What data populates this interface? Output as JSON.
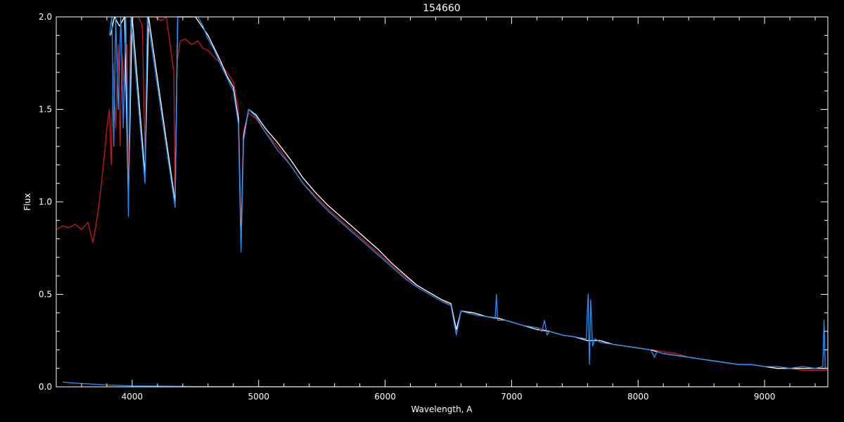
{
  "colors": {
    "background": "#000000",
    "axes": "#ffffff",
    "observed": "#ffffff",
    "model": "#d01818",
    "blue_spectrum": "#1e90ff"
  },
  "chart_data": {
    "type": "line",
    "title": "154660",
    "xlabel": "Wavelength, A",
    "ylabel": "Flux",
    "xlim": [
      3400,
      9500
    ],
    "ylim": [
      0,
      2.0
    ],
    "xticks": [
      4000,
      5000,
      6000,
      7000,
      8000,
      9000
    ],
    "xtick_labels": [
      "4000",
      "5000",
      "6000",
      "7000",
      "8000",
      "9000"
    ],
    "yticks": [
      0.0,
      0.5,
      1.0,
      1.5,
      2.0
    ],
    "ytick_labels": [
      "0.0",
      "0.5",
      "1.0",
      "1.5",
      "2.0"
    ],
    "x_minor_step": 200,
    "y_minor_step": 0.1,
    "grid": false,
    "legend": "none",
    "series": [
      {
        "key": "model",
        "color": "#d01818",
        "points": [
          [
            3400,
            0.85
          ],
          [
            3450,
            0.87
          ],
          [
            3500,
            0.86
          ],
          [
            3550,
            0.88
          ],
          [
            3600,
            0.85
          ],
          [
            3650,
            0.89
          ],
          [
            3690,
            0.78
          ],
          [
            3720,
            0.9
          ],
          [
            3750,
            1.05
          ],
          [
            3780,
            1.25
          ],
          [
            3800,
            1.4
          ],
          [
            3820,
            1.5
          ],
          [
            3835,
            1.2
          ],
          [
            3850,
            1.75
          ],
          [
            3870,
            1.4
          ],
          [
            3890,
            1.85
          ],
          [
            3905,
            1.3
          ],
          [
            3920,
            1.8
          ],
          [
            3940,
            1.6
          ],
          [
            3960,
            1.85
          ],
          [
            3970,
            0.95
          ],
          [
            3985,
            1.9
          ],
          [
            4010,
            2.0
          ],
          [
            4050,
            2.0
          ],
          [
            4080,
            1.95
          ],
          [
            4102,
            1.25
          ],
          [
            4125,
            2.0
          ],
          [
            4180,
            2.0
          ],
          [
            4230,
            1.98
          ],
          [
            4270,
            2.0
          ],
          [
            4300,
            1.85
          ],
          [
            4330,
            1.7
          ],
          [
            4340,
            1.0
          ],
          [
            4355,
            1.75
          ],
          [
            4380,
            1.87
          ],
          [
            4420,
            1.88
          ],
          [
            4470,
            1.85
          ],
          [
            4520,
            1.87
          ],
          [
            4560,
            1.83
          ],
          [
            4600,
            1.82
          ],
          [
            4650,
            1.78
          ],
          [
            4700,
            1.75
          ],
          [
            4750,
            1.7
          ],
          [
            4800,
            1.65
          ],
          [
            4840,
            1.5
          ],
          [
            4861,
            0.8
          ],
          [
            4880,
            1.38
          ],
          [
            4920,
            1.48
          ],
          [
            4980,
            1.45
          ],
          [
            5050,
            1.38
          ],
          [
            5150,
            1.3
          ],
          [
            5250,
            1.2
          ],
          [
            5350,
            1.1
          ],
          [
            5450,
            1.03
          ],
          [
            5550,
            0.96
          ],
          [
            5650,
            0.9
          ],
          [
            5750,
            0.84
          ],
          [
            5850,
            0.78
          ],
          [
            5950,
            0.72
          ],
          [
            6050,
            0.66
          ],
          [
            6150,
            0.6
          ],
          [
            6250,
            0.55
          ],
          [
            6350,
            0.51
          ],
          [
            6450,
            0.47
          ],
          [
            6520,
            0.44
          ],
          [
            6563,
            0.29
          ],
          [
            6600,
            0.41
          ],
          [
            6700,
            0.4
          ],
          [
            6800,
            0.38
          ],
          [
            6900,
            0.37
          ],
          [
            7000,
            0.35
          ],
          [
            7100,
            0.33
          ],
          [
            7200,
            0.32
          ],
          [
            7300,
            0.3
          ],
          [
            7400,
            0.28
          ],
          [
            7500,
            0.27
          ],
          [
            7600,
            0.25
          ],
          [
            7700,
            0.25
          ],
          [
            7800,
            0.23
          ],
          [
            7900,
            0.22
          ],
          [
            8000,
            0.21
          ],
          [
            8100,
            0.2
          ],
          [
            8200,
            0.19
          ],
          [
            8300,
            0.18
          ],
          [
            8400,
            0.16
          ],
          [
            8500,
            0.15
          ],
          [
            8600,
            0.14
          ],
          [
            8700,
            0.13
          ],
          [
            8800,
            0.12
          ],
          [
            8900,
            0.12
          ],
          [
            9000,
            0.11
          ],
          [
            9100,
            0.1
          ],
          [
            9200,
            0.1
          ],
          [
            9300,
            0.09
          ],
          [
            9400,
            0.09
          ],
          [
            9500,
            0.09
          ]
        ]
      },
      {
        "key": "observed",
        "color": "#ffffff",
        "points": [
          [
            3830,
            1.9
          ],
          [
            3860,
            2.0
          ],
          [
            3900,
            1.95
          ],
          [
            3940,
            2.0
          ],
          [
            3970,
            1.0
          ],
          [
            4000,
            2.0
          ],
          [
            4102,
            1.15
          ],
          [
            4130,
            2.0
          ],
          [
            4340,
            1.0
          ],
          [
            4360,
            2.0
          ],
          [
            4500,
            2.0
          ],
          [
            4550,
            1.95
          ],
          [
            4600,
            1.9
          ],
          [
            4650,
            1.83
          ],
          [
            4700,
            1.76
          ],
          [
            4750,
            1.68
          ],
          [
            4800,
            1.62
          ],
          [
            4840,
            1.45
          ],
          [
            4861,
            0.76
          ],
          [
            4880,
            1.35
          ],
          [
            4920,
            1.5
          ],
          [
            4980,
            1.47
          ],
          [
            5050,
            1.4
          ],
          [
            5150,
            1.32
          ],
          [
            5250,
            1.23
          ],
          [
            5350,
            1.13
          ],
          [
            5450,
            1.05
          ],
          [
            5550,
            0.98
          ],
          [
            5650,
            0.92
          ],
          [
            5750,
            0.86
          ],
          [
            5850,
            0.8
          ],
          [
            5950,
            0.74
          ],
          [
            6050,
            0.67
          ],
          [
            6150,
            0.61
          ],
          [
            6250,
            0.55
          ],
          [
            6350,
            0.51
          ],
          [
            6450,
            0.47
          ],
          [
            6520,
            0.45
          ],
          [
            6563,
            0.31
          ],
          [
            6600,
            0.41
          ],
          [
            6700,
            0.4
          ],
          [
            6800,
            0.38
          ],
          [
            6900,
            0.37
          ],
          [
            7000,
            0.35
          ],
          [
            7100,
            0.33
          ],
          [
            7200,
            0.31
          ],
          [
            7300,
            0.3
          ],
          [
            7400,
            0.28
          ],
          [
            7500,
            0.27
          ],
          [
            7600,
            0.25
          ],
          [
            7700,
            0.25
          ],
          [
            7800,
            0.23
          ],
          [
            7900,
            0.22
          ],
          [
            8000,
            0.21
          ],
          [
            8100,
            0.2
          ],
          [
            8200,
            0.18
          ],
          [
            8300,
            0.17
          ],
          [
            8400,
            0.16
          ],
          [
            8500,
            0.15
          ],
          [
            8600,
            0.14
          ],
          [
            8700,
            0.13
          ],
          [
            8800,
            0.12
          ],
          [
            8900,
            0.12
          ],
          [
            9000,
            0.11
          ],
          [
            9100,
            0.1
          ],
          [
            9200,
            0.1
          ],
          [
            9300,
            0.1
          ],
          [
            9400,
            0.1
          ],
          [
            9500,
            0.1
          ]
        ]
      },
      {
        "key": "blue_spectrum",
        "color": "#1e90ff",
        "points": [
          [
            3820,
            1.9
          ],
          [
            3840,
            2.0
          ],
          [
            3855,
            1.3
          ],
          [
            3870,
            2.0
          ],
          [
            3890,
            1.5
          ],
          [
            3910,
            2.0
          ],
          [
            3930,
            1.4
          ],
          [
            3950,
            2.0
          ],
          [
            3970,
            0.92
          ],
          [
            3990,
            2.0
          ],
          [
            4102,
            1.1
          ],
          [
            4120,
            2.0
          ],
          [
            4340,
            0.97
          ],
          [
            4360,
            2.0
          ],
          [
            4520,
            2.0
          ],
          [
            4560,
            1.95
          ],
          [
            4600,
            1.88
          ],
          [
            4650,
            1.82
          ],
          [
            4700,
            1.74
          ],
          [
            4750,
            1.67
          ],
          [
            4800,
            1.6
          ],
          [
            4840,
            1.42
          ],
          [
            4861,
            0.73
          ],
          [
            4880,
            1.33
          ],
          [
            4920,
            1.5
          ],
          [
            4980,
            1.46
          ],
          [
            5050,
            1.38
          ],
          [
            5150,
            1.28
          ],
          [
            5250,
            1.2
          ],
          [
            5350,
            1.1
          ],
          [
            5450,
            1.02
          ],
          [
            5550,
            0.95
          ],
          [
            5650,
            0.89
          ],
          [
            5750,
            0.83
          ],
          [
            5850,
            0.77
          ],
          [
            5950,
            0.71
          ],
          [
            6050,
            0.65
          ],
          [
            6150,
            0.59
          ],
          [
            6250,
            0.54
          ],
          [
            6350,
            0.5
          ],
          [
            6450,
            0.46
          ],
          [
            6520,
            0.44
          ],
          [
            6563,
            0.28
          ],
          [
            6600,
            0.41
          ],
          [
            6700,
            0.39
          ],
          [
            6800,
            0.38
          ],
          [
            6870,
            0.37
          ],
          [
            6880,
            0.5
          ],
          [
            6890,
            0.36
          ],
          [
            6950,
            0.36
          ],
          [
            7000,
            0.35
          ],
          [
            7100,
            0.33
          ],
          [
            7200,
            0.32
          ],
          [
            7240,
            0.3
          ],
          [
            7260,
            0.36
          ],
          [
            7280,
            0.28
          ],
          [
            7300,
            0.3
          ],
          [
            7400,
            0.28
          ],
          [
            7500,
            0.27
          ],
          [
            7590,
            0.26
          ],
          [
            7605,
            0.5
          ],
          [
            7615,
            0.12
          ],
          [
            7625,
            0.47
          ],
          [
            7640,
            0.22
          ],
          [
            7660,
            0.26
          ],
          [
            7700,
            0.24
          ],
          [
            7800,
            0.23
          ],
          [
            7900,
            0.22
          ],
          [
            8000,
            0.21
          ],
          [
            8100,
            0.2
          ],
          [
            8130,
            0.16
          ],
          [
            8150,
            0.19
          ],
          [
            8200,
            0.18
          ],
          [
            8300,
            0.17
          ],
          [
            8400,
            0.16
          ],
          [
            8500,
            0.15
          ],
          [
            8600,
            0.14
          ],
          [
            8700,
            0.13
          ],
          [
            8800,
            0.12
          ],
          [
            8900,
            0.12
          ],
          [
            9000,
            0.11
          ],
          [
            9100,
            0.11
          ],
          [
            9200,
            0.1
          ],
          [
            9300,
            0.11
          ],
          [
            9400,
            0.1
          ],
          [
            9460,
            0.11
          ],
          [
            9470,
            0.36
          ],
          [
            9480,
            0.1
          ],
          [
            9500,
            0.1
          ]
        ]
      },
      {
        "key": "blue_low",
        "color": "#1e90ff",
        "points": [
          [
            3450,
            0.025
          ],
          [
            3600,
            0.018
          ],
          [
            3800,
            0.01
          ],
          [
            4000,
            0.005
          ],
          [
            4500,
            0.002
          ],
          [
            5000,
            0.001
          ],
          [
            6000,
            0.0005
          ],
          [
            7000,
            0.0003
          ],
          [
            9500,
            0.0002
          ]
        ]
      }
    ],
    "absorption_features": [
      {
        "x": 3970,
        "depth": 0.9
      },
      {
        "x": 4102,
        "depth": 0.85
      },
      {
        "x": 4340,
        "depth": 1.0
      },
      {
        "x": 4861,
        "depth": 0.7
      },
      {
        "x": 6563,
        "depth": 0.15
      }
    ]
  }
}
